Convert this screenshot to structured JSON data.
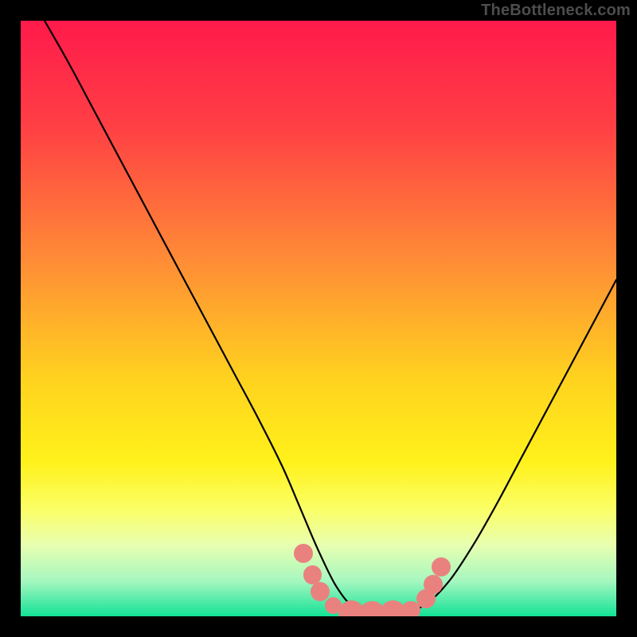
{
  "watermark": {
    "text": "TheBottleneck.com"
  },
  "colors": {
    "black": "#000000",
    "curve": "#000000",
    "marker": "#e9827f",
    "gradient_stops": [
      {
        "pct": 0,
        "color": "#ff1a4b"
      },
      {
        "pct": 18,
        "color": "#ff4044"
      },
      {
        "pct": 40,
        "color": "#ff8b36"
      },
      {
        "pct": 60,
        "color": "#ffd21f"
      },
      {
        "pct": 74,
        "color": "#fff11a"
      },
      {
        "pct": 82,
        "color": "#fbff66"
      },
      {
        "pct": 88,
        "color": "#e8ffb0"
      },
      {
        "pct": 94,
        "color": "#a7f7c0"
      },
      {
        "pct": 100,
        "color": "#13e296"
      }
    ]
  },
  "chart_data": {
    "type": "line",
    "title": "",
    "xlabel": "",
    "ylabel": "",
    "xlim": [
      0,
      100
    ],
    "ylim": [
      0,
      100
    ],
    "grid": false,
    "series": [
      {
        "name": "bottleneck-curve",
        "x": [
          4,
          8,
          12,
          16,
          20,
          24,
          28,
          32,
          36,
          40,
          44,
          47,
          50,
          53,
          56,
          60,
          64,
          68,
          72,
          76,
          80,
          84,
          88,
          92,
          96,
          100
        ],
        "y": [
          100,
          93,
          85.5,
          78,
          70.5,
          63,
          55.5,
          48,
          40.5,
          33,
          25,
          18,
          11,
          5,
          1.5,
          0.5,
          0.5,
          2,
          6,
          12,
          19,
          26.5,
          34,
          41.5,
          49,
          56.5
        ]
      }
    ],
    "markers": [
      {
        "x": 47.5,
        "y": 10.5,
        "r": 1.6
      },
      {
        "x": 49.0,
        "y": 7.0,
        "r": 1.6
      },
      {
        "x": 50.3,
        "y": 4.2,
        "r": 1.6
      },
      {
        "x": 52.5,
        "y": 1.8,
        "r": 1.4
      },
      {
        "x": 55.5,
        "y": 0.5,
        "r": 2.2
      },
      {
        "x": 59.0,
        "y": 0.4,
        "r": 2.2
      },
      {
        "x": 62.5,
        "y": 0.5,
        "r": 2.2
      },
      {
        "x": 65.5,
        "y": 1.0,
        "r": 1.6
      },
      {
        "x": 68.0,
        "y": 3.0,
        "r": 1.6
      },
      {
        "x": 69.3,
        "y": 5.4,
        "r": 1.6
      },
      {
        "x": 70.6,
        "y": 8.3,
        "r": 1.6
      }
    ]
  }
}
